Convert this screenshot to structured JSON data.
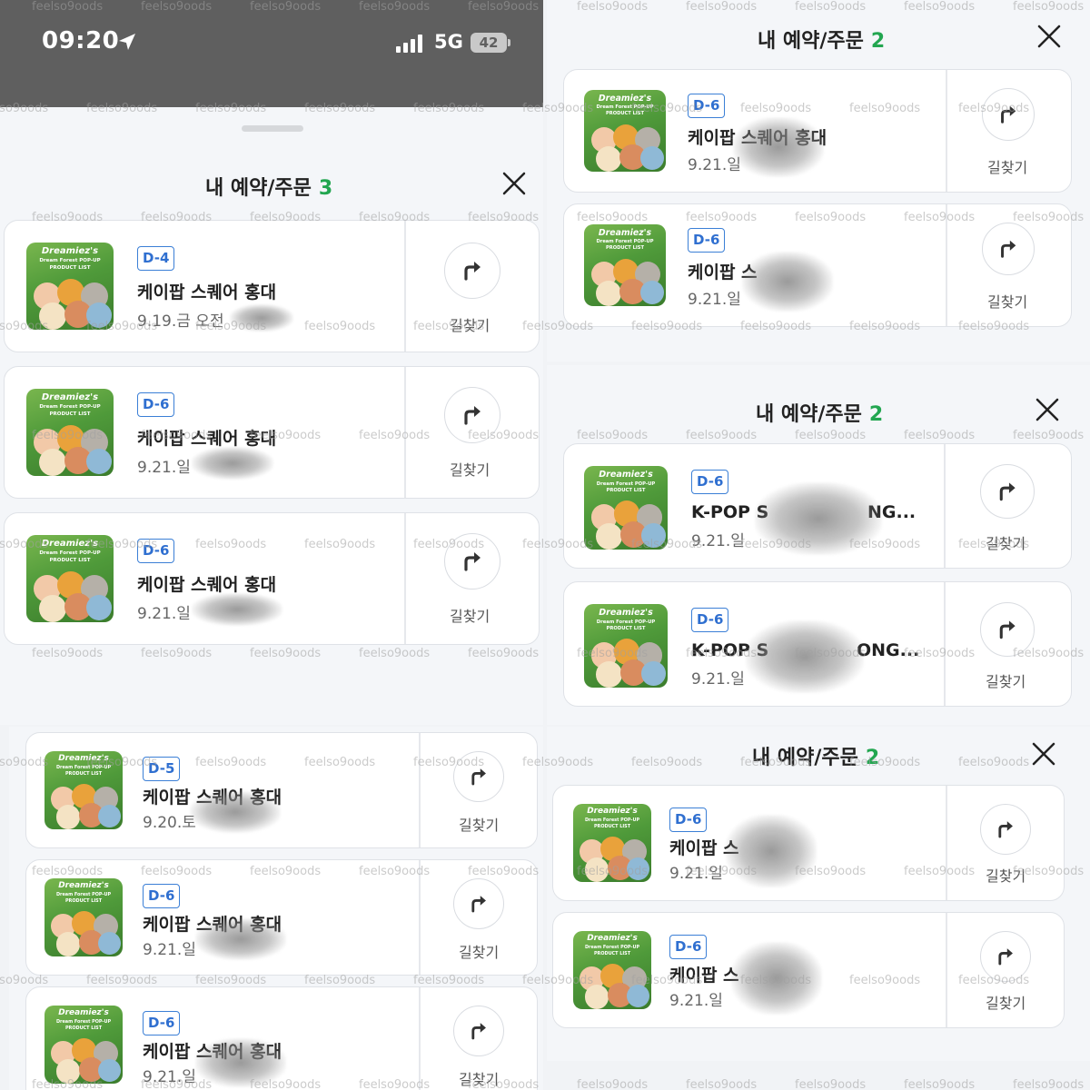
{
  "status_bar": {
    "time": "09:20",
    "network": "5G",
    "battery": "42",
    "icons": [
      "location-arrow-icon",
      "signal-bars-icon",
      "battery-icon"
    ]
  },
  "watermark": "feelso9oods",
  "colors": {
    "count_green": "#22a650",
    "badge_blue": "#2f6fd0",
    "status_bar_bg": "#5f5f5f"
  },
  "thumbnail": {
    "title": "Dreamiez's",
    "subtitle": "Dream Forest POP-UP",
    "caption": "PRODUCT LIST"
  },
  "direction_label": "길찾기",
  "panels": [
    {
      "title": "내 예약/주문",
      "count": "3",
      "cards": [
        {
          "dday": "D-4",
          "place": "케이팝 스퀘어 홍대",
          "date": "9.19.금 오전"
        },
        {
          "dday": "D-6",
          "place": "케이팝 스퀘어 홍대",
          "date": "9.21.일"
        },
        {
          "dday": "D-6",
          "place": "케이팝 스퀘어 홍대",
          "date": "9.21.일"
        }
      ]
    },
    {
      "title": "내 예약/주문",
      "count": "2",
      "cards": [
        {
          "dday": "D-6",
          "place": "케이팝 스퀘어 홍대",
          "date": "9.21.일"
        },
        {
          "dday": "D-6",
          "place": "케이팝 스",
          "date": "9.21.일"
        }
      ]
    },
    {
      "title": "내 예약/주문",
      "count": "2",
      "cards": [
        {
          "dday": "D-6",
          "place": "K-POP S",
          "place_end": "NG...",
          "date": "9.21.일"
        },
        {
          "dday": "D-6",
          "place": "K-POP S",
          "place_end": "ONG...",
          "date": "9.21.일"
        }
      ]
    },
    {
      "title": "",
      "count": "",
      "cards": [
        {
          "dday": "D-5",
          "place": "케이팝 스퀘어 홍대",
          "date": "9.20.토"
        },
        {
          "dday": "D-6",
          "place": "케이팝 스퀘어 홍대",
          "date": "9.21.일"
        },
        {
          "dday": "D-6",
          "place": "케이팝 스퀘어 홍대",
          "date": "9.21.일"
        }
      ]
    },
    {
      "title": "내 예약/주문",
      "count": "2",
      "cards": [
        {
          "dday": "D-6",
          "place": "케이팝 스",
          "date": "9.21.일"
        },
        {
          "dday": "D-6",
          "place": "케이팝 스",
          "date": "9.21.일"
        }
      ]
    }
  ]
}
